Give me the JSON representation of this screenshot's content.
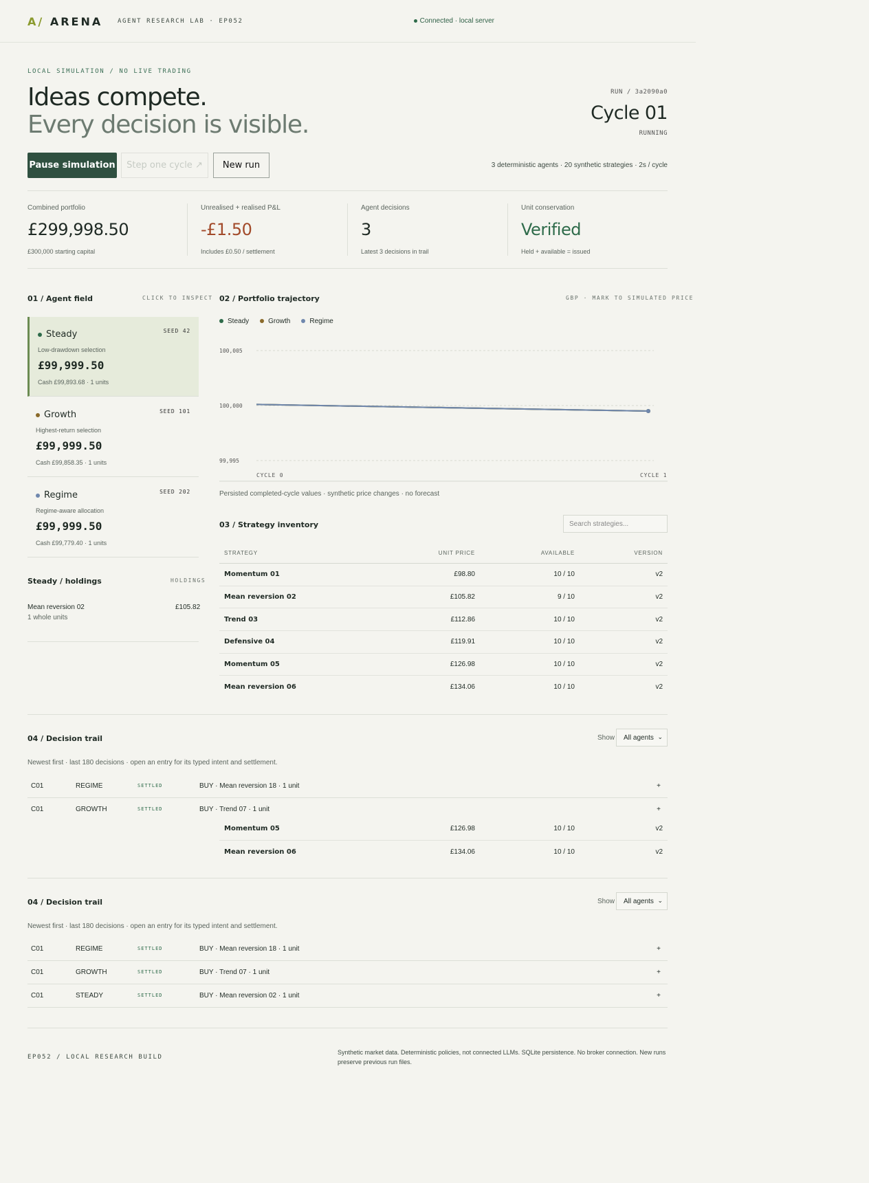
{
  "header": {
    "logo_mark": "A/",
    "logo_text": "ARENA",
    "lab": "AGENT RESEARCH LAB · EP052",
    "connection": "Connected · local server"
  },
  "hero": {
    "eyebrow": "LOCAL SIMULATION / NO LIVE TRADING",
    "title_line1": "Ideas compete.",
    "title_line2": "Every decision is visible.",
    "run_id": "RUN / 3a2090a0",
    "cycle": "Cycle 01",
    "status": "RUNNING"
  },
  "controls": {
    "pause": "Pause simulation",
    "step": "Step one cycle ↗",
    "new_run": "New run",
    "note": "3 deterministic agents · 20 synthetic strategies · 2s / cycle"
  },
  "stats": [
    {
      "label": "Combined portfolio",
      "value": "£299,998.50",
      "sub": "£300,000 starting capital",
      "color": "#1f2a24"
    },
    {
      "label": "Unrealised + realised P&L",
      "value": "-£1.50",
      "sub": "Includes £0.50 / settlement",
      "color": "#a24a2a"
    },
    {
      "label": "Agent decisions",
      "value": "3",
      "sub": "Latest 3 decisions in trail",
      "color": "#1f2a24"
    },
    {
      "label": "Unit conservation",
      "value": "Verified",
      "sub": "Held + available = issued",
      "color": "#2e6b4a"
    }
  ],
  "agent_field": {
    "title": "01 / Agent field",
    "hint": "CLICK TO INSPECT",
    "agents": [
      {
        "name": "Steady",
        "seed": "SEED 42",
        "desc": "Low-drawdown selection",
        "balance": "£99,999.50",
        "cash": "Cash £99,893.68 · 1 units",
        "color": "#2e6b4a"
      },
      {
        "name": "Growth",
        "seed": "SEED 101",
        "desc": "Highest-return selection",
        "balance": "£99,999.50",
        "cash": "Cash £99,858.35 · 1 units",
        "color": "#8a6a2a"
      },
      {
        "name": "Regime",
        "seed": "SEED 202",
        "desc": "Regime-aware allocation",
        "balance": "£99,999.50",
        "cash": "Cash £99,779.40 · 1 units",
        "color": "#6f87ad"
      }
    ]
  },
  "holdings": {
    "title": "Steady / holdings",
    "tag": "HOLDINGS",
    "name": "Mean reversion 02",
    "units": "1 whole units",
    "value": "£105.82"
  },
  "trajectory": {
    "title": "02 / Portfolio trajectory",
    "tag": "GBP · MARK TO SIMULATED PRICE",
    "note": "Persisted completed-cycle values · synthetic price changes · no forecast"
  },
  "chart_data": {
    "type": "line",
    "x": [
      "CYCLE 0",
      "CYCLE 1"
    ],
    "yticks": [
      "100,005",
      "100,000",
      "99,995"
    ],
    "ylim": [
      99995,
      100005
    ],
    "series": [
      {
        "name": "Steady",
        "color": "#2e6b4a",
        "values": [
          100000.1,
          99999.5
        ]
      },
      {
        "name": "Growth",
        "color": "#8a6a2a",
        "values": [
          100000.1,
          99999.5
        ]
      },
      {
        "name": "Regime",
        "color": "#6f87ad",
        "values": [
          100000.1,
          99999.5
        ]
      }
    ]
  },
  "inventory": {
    "title": "03 / Strategy inventory",
    "search_placeholder": "Search strategies...",
    "columns": [
      "STRATEGY",
      "UNIT PRICE",
      "AVAILABLE",
      "VERSION"
    ],
    "rows": [
      [
        "Momentum 01",
        "£98.80",
        "10 / 10",
        "v2"
      ],
      [
        "Mean reversion 02",
        "£105.82",
        "9 / 10",
        "v2"
      ],
      [
        "Trend 03",
        "£112.86",
        "10 / 10",
        "v2"
      ],
      [
        "Defensive 04",
        "£119.91",
        "10 / 10",
        "v2"
      ],
      [
        "Momentum 05",
        "£126.98",
        "10 / 10",
        "v2"
      ],
      [
        "Mean reversion 06",
        "£134.06",
        "10 / 10",
        "v2"
      ]
    ]
  },
  "trail": {
    "title": "04 / Decision trail",
    "show": "Show",
    "filter": "All agents",
    "note": "Newest first · last 180 decisions · open an entry for its typed intent and settlement.",
    "rows": [
      [
        "C01",
        "REGIME",
        "SETTLED",
        "BUY · Mean reversion 18 · 1 unit",
        "+"
      ],
      [
        "C01",
        "GROWTH",
        "SETTLED",
        "BUY · Trend 07 · 1 unit",
        "+"
      ],
      [
        "C01",
        "STEADY",
        "SETTLED",
        "BUY · Mean reversion 02 · 1 unit",
        "+"
      ]
    ]
  },
  "footer": {
    "build": "EP052 / LOCAL RESEARCH BUILD",
    "disclaimer": "Synthetic market data. Deterministic policies, not connected LLMs. SQLite persistence. No broker connection. New runs preserve previous run files."
  }
}
